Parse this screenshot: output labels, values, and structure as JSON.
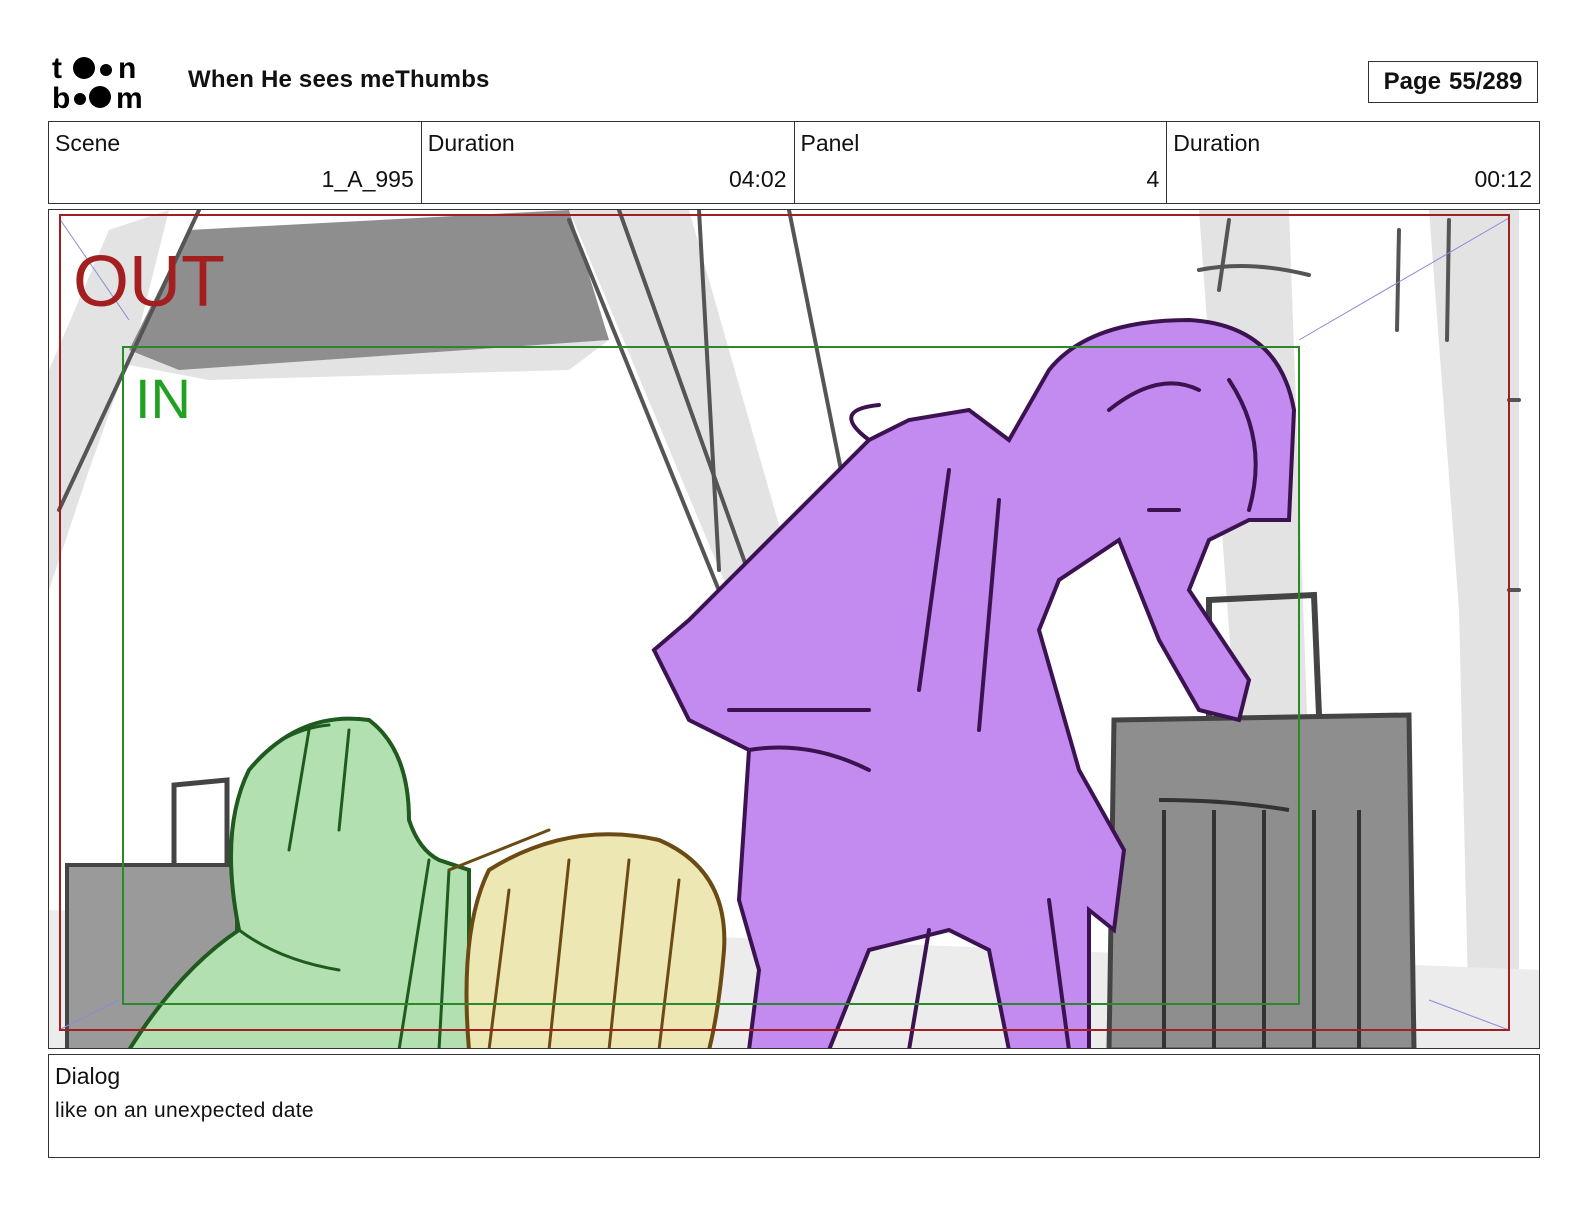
{
  "header": {
    "logo_text_line1": "toon",
    "logo_text_line2": "boom",
    "title": "When He sees meThumbs",
    "page_label": "Page",
    "page_value": "55/289"
  },
  "info": [
    {
      "label": "Scene",
      "value": "1_A_995"
    },
    {
      "label": "Duration",
      "value": "04:02"
    },
    {
      "label": "Panel",
      "value": "4"
    },
    {
      "label": "Duration",
      "value": "00:12"
    }
  ],
  "panel": {
    "out_label": "OUT",
    "in_label": "IN",
    "colors": {
      "out_frame": "#a31f1f",
      "in_frame": "#2a8a2a",
      "in_text": "#22a022",
      "purple_fill": "#c38af0",
      "purple_line": "#3b1350",
      "green_fill": "#b2e0b0",
      "green_line": "#1f5a1f",
      "yellow_fill": "#ede7b4",
      "yellow_line": "#6b4a14",
      "gray_fill": "#9a9a9a",
      "light_gray": "#e3e3e3",
      "sketch_line": "#555555"
    }
  },
  "dialog": {
    "label": "Dialog",
    "text": "like on an unexpected date"
  }
}
